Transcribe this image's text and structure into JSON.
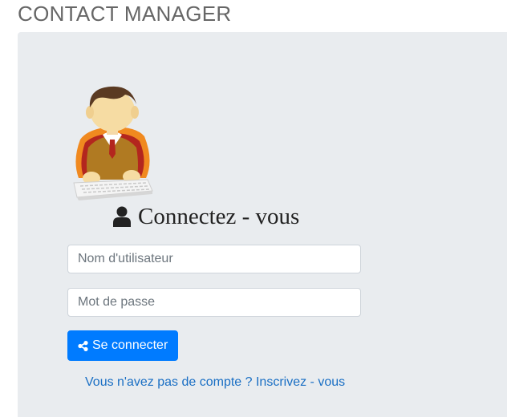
{
  "app": {
    "title": "CONTACT MANAGER"
  },
  "login": {
    "heading": "Connectez - vous",
    "heading_icon": "user-icon",
    "avatar_icon": "user-at-keyboard-illustration",
    "username_placeholder": "Nom d'utilisateur",
    "username_value": "",
    "password_placeholder": "Mot de passe",
    "password_value": "",
    "submit_label": "Se connecter",
    "submit_icon": "share-icon",
    "signup_link": "Vous n'avez pas de compte ? Inscrivez - vous"
  },
  "colors": {
    "primary": "#007bff",
    "panel_background": "#e9ecef",
    "link": "#1a6fc4",
    "title": "#666666"
  }
}
